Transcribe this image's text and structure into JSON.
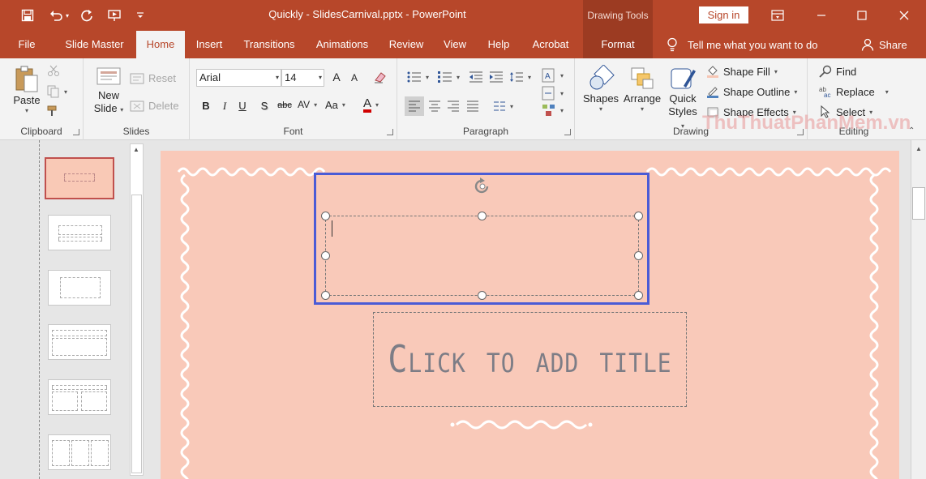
{
  "titlebar": {
    "doc_title": "Quickly - SlidesCarnival.pptx  -  PowerPoint",
    "drawing_tools": "Drawing Tools",
    "sign_in": "Sign in"
  },
  "tabs": {
    "file": "File",
    "slide_master": "Slide Master",
    "home": "Home",
    "insert": "Insert",
    "transitions": "Transitions",
    "animations": "Animations",
    "review": "Review",
    "view": "View",
    "help": "Help",
    "acrobat": "Acrobat",
    "format": "Format",
    "tell_me": "Tell me what you want to do",
    "share": "Share"
  },
  "ribbon": {
    "clipboard": {
      "label": "Clipboard",
      "paste": "Paste"
    },
    "slides": {
      "label": "Slides",
      "new_slide_1": "New",
      "new_slide_2": "Slide",
      "reset": "Reset",
      "delete": "Delete"
    },
    "font": {
      "label": "Font",
      "font_name": "Arial",
      "font_size": "14",
      "bold": "B",
      "italic": "I",
      "underline": "U",
      "shadow": "S",
      "strikethrough": "abc",
      "spacing": "AV",
      "case": "Aa",
      "color": "A",
      "grow": "A",
      "shrink": "A"
    },
    "paragraph": {
      "label": "Paragraph"
    },
    "drawing": {
      "label": "Drawing",
      "shapes": "Shapes",
      "arrange": "Arrange",
      "quick_styles_1": "Quick",
      "quick_styles_2": "Styles",
      "shape_fill": "Shape Fill",
      "shape_outline": "Shape Outline",
      "shape_effects": "Shape Effects"
    },
    "editing": {
      "label": "Editing",
      "find": "Find",
      "replace": "Replace",
      "select": "Select"
    }
  },
  "slide": {
    "title_placeholder": "Click to add title"
  },
  "watermark": "ThuThuatPhanMem.vn",
  "colors": {
    "accent": "#b7472a",
    "slide_bg": "#f9c9b9",
    "selection": "#4a5bd6"
  }
}
